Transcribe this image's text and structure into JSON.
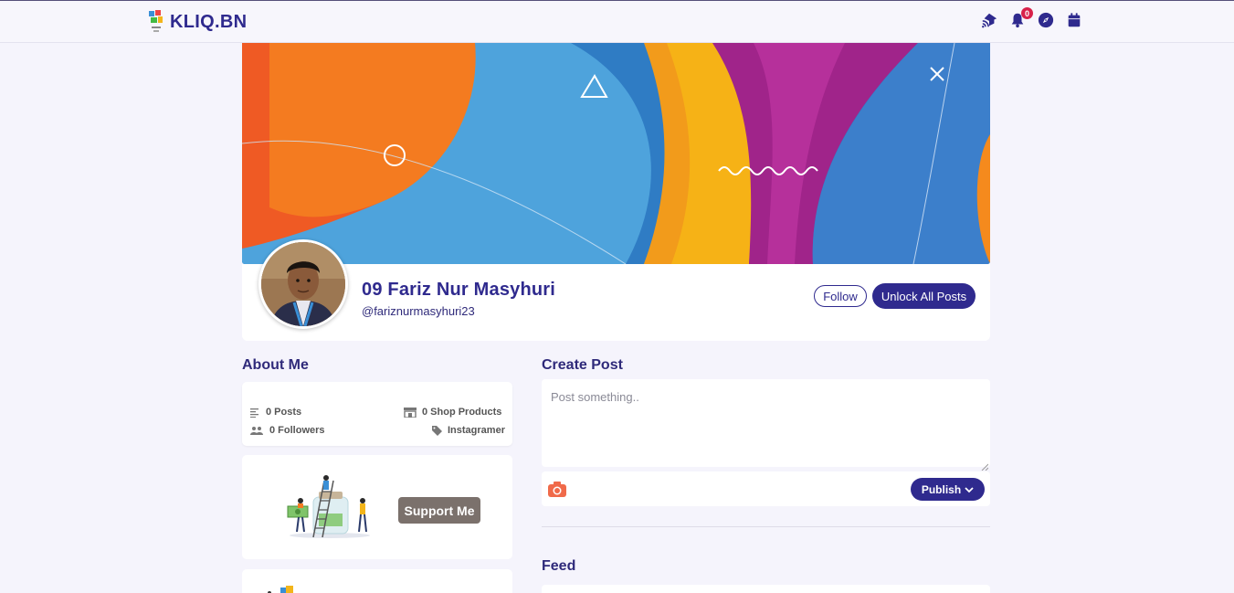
{
  "navbar": {
    "brand": "KLIQ.BN",
    "icons": [
      "feed-icon",
      "bell-icon",
      "compass-icon",
      "calendar-icon"
    ],
    "notification_count": "0"
  },
  "profile": {
    "name": "09 Fariz Nur Masyhuri",
    "handle": "@fariznurmasyhuri23",
    "follow_label": "Follow",
    "unlock_label": "Unlock All Posts"
  },
  "about": {
    "title": "About Me",
    "posts": "0 Posts",
    "shop_products": "0 Shop Products",
    "followers": "0 Followers",
    "category": "Instagramer",
    "support_label": "Support Me"
  },
  "create_post": {
    "title": "Create Post",
    "placeholder": "Post something..",
    "publish_label": "Publish"
  },
  "feed": {
    "title": "Feed"
  },
  "colors": {
    "primary": "#2f2a8e",
    "background": "#f5f4fc",
    "support_button": "#7b716c",
    "badge": "#d8214a"
  }
}
